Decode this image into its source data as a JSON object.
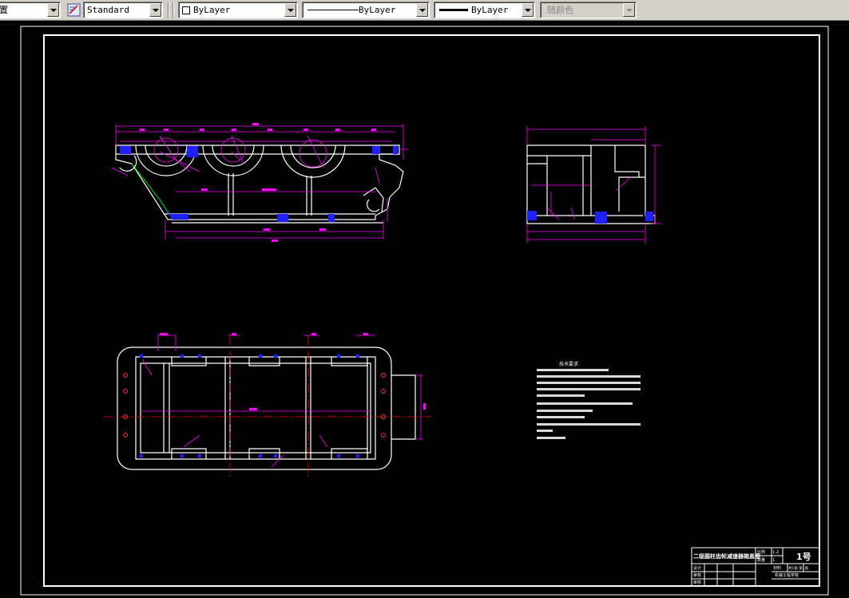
{
  "toolbar": {
    "text_style_clip": "置",
    "dim_style_value": "Standard",
    "layer_value": "ByLayer",
    "linetype_value": "ByLayer",
    "lineweight_value": "ByLayer",
    "plot_style_value": "随颜色"
  },
  "colors": {
    "background": "#000000",
    "geometry": "#ffffff",
    "dimension": "#ff00ff",
    "hatch": "#0000ff",
    "centerline": "#ff0000",
    "text_note": "#ffffff",
    "green": "#00c000"
  },
  "drawing": {
    "technical_requirements_title": "技术要求",
    "title_block": {
      "drawing_name": "二级圆柱齿轮减速器箱盖图",
      "sheet_size": "1号",
      "scale_label": "比例",
      "scale_value": "1:2",
      "qty_label": "数量",
      "qty_value": "1",
      "sheet_info": "共1张 第1张",
      "material_label": "材料",
      "designer_label": "设计",
      "checker_label": "审核",
      "approver_label": "审核",
      "school": "机械工程学院"
    }
  }
}
